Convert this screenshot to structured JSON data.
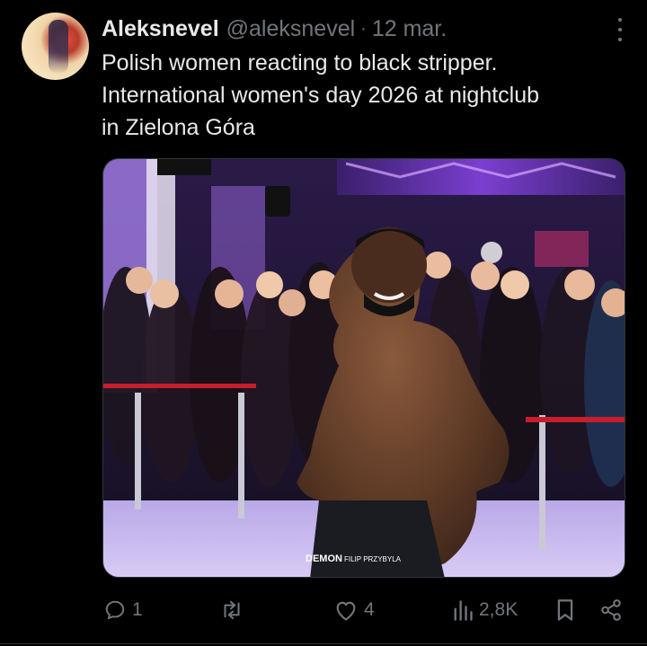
{
  "tweet": {
    "display_name": "Aleksnevel",
    "handle": "@aleksnevel",
    "separator": "·",
    "date": "12 mar.",
    "text_lines": [
      "Polish women reacting to black stripper.",
      "International women's day 2026 at nightclub",
      "in Zielona Góra"
    ],
    "watermark_brand": "DEMON",
    "watermark_name": "FILIP PRZYBYLA"
  },
  "actions": {
    "replies": "1",
    "reposts": "",
    "likes": "4",
    "views": "2,8K"
  },
  "icons": {
    "avatar": "avatar",
    "more": "more-dots-icon",
    "reply": "reply-icon",
    "repost": "repost-icon",
    "like": "heart-icon",
    "views": "views-chart-icon",
    "bookmark": "bookmark-icon",
    "share": "share-icon"
  },
  "colors": {
    "background": "#000000",
    "text_primary": "#e7e9ea",
    "text_secondary": "#71767b",
    "border": "#2f3336"
  }
}
